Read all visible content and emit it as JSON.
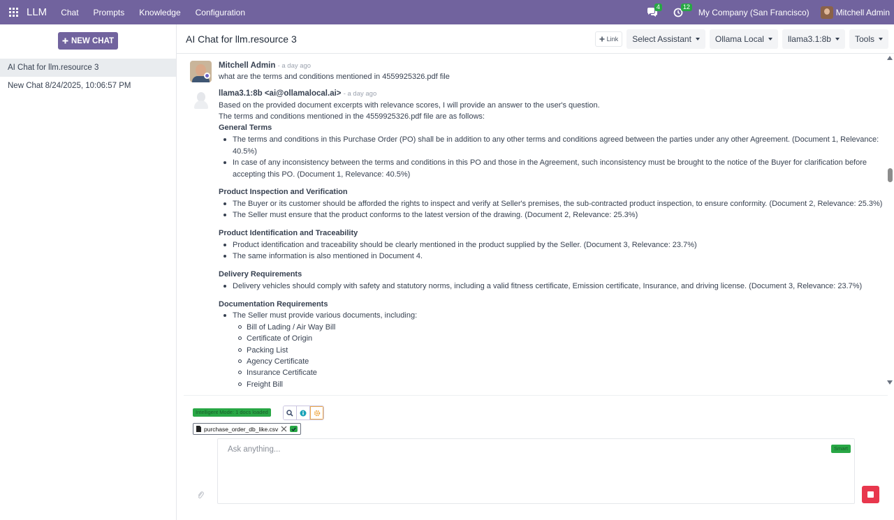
{
  "topbar": {
    "brand": "LLM",
    "menu": [
      "Chat",
      "Prompts",
      "Knowledge",
      "Configuration"
    ],
    "messages_count": "4",
    "activities_count": "12",
    "company": "My Company (San Francisco)",
    "user": "Mitchell Admin"
  },
  "sidebar": {
    "new_chat_label": "NEW CHAT",
    "items": [
      {
        "label": "AI Chat for llm.resource 3",
        "active": true
      },
      {
        "label": "New Chat 8/24/2025, 10:06:57 PM",
        "active": false
      }
    ]
  },
  "header": {
    "title": "AI Chat for llm.resource 3",
    "link_label": "Link",
    "assistant": "Select Assistant",
    "provider": "Ollama Local",
    "model": "llama3.1:8b",
    "tools": "Tools"
  },
  "messages": {
    "user": {
      "author": "Mitchell Admin",
      "time": "- a day ago",
      "text": "what are the terms and conditions mentioned in 4559925326.pdf file"
    },
    "bot": {
      "author": "llama3.1:8b <ai@ollamalocal.ai>",
      "time": "- a day ago",
      "intro1": "Based on the provided document excerpts with relevance scores, I will provide an answer to the user's question.",
      "intro2": "The terms and conditions mentioned in the 4559925326.pdf file are as follows:",
      "sections": [
        {
          "title": "General Terms",
          "bullets": [
            "The terms and conditions in this Purchase Order (PO) shall be in addition to any other terms and conditions agreed between the parties under any other Agreement. (Document 1, Relevance: 40.5%)",
            "In case of any inconsistency between the terms and conditions in this PO and those in the Agreement, such inconsistency must be brought to the notice of the Buyer for clarification before accepting this PO. (Document 1, Relevance: 40.5%)"
          ]
        },
        {
          "title": "Product Inspection and Verification",
          "bullets": [
            "The Buyer or its customer should be afforded the rights to inspect and verify at Seller's premises, the sub-contracted product inspection, to ensure conformity. (Document 2, Relevance: 25.3%)",
            "The Seller must ensure that the product conforms to the latest version of the drawing. (Document 2, Relevance: 25.3%)"
          ]
        },
        {
          "title": "Product Identification and Traceability",
          "bullets": [
            "Product identification and traceability should be clearly mentioned in the product supplied by the Seller. (Document 3, Relevance: 23.7%)",
            "The same information is also mentioned in Document 4."
          ]
        },
        {
          "title": "Delivery Requirements",
          "bullets": [
            "Delivery vehicles should comply with safety and statutory norms, including a valid fitness certificate, Emission certificate, Insurance, and driving license. (Document 3, Relevance: 23.7%)"
          ]
        },
        {
          "title": "Documentation Requirements",
          "bullets": [
            "The Seller must provide various documents, including:"
          ],
          "sub_bullets": [
            "Bill of Lading / Air Way Bill",
            "Certificate of Origin",
            "Packing List",
            "Agency Certificate",
            "Insurance Certificate",
            "Freight Bill"
          ]
        }
      ]
    }
  },
  "composer": {
    "mode_badge": "Intelligent Mode: 1 docs loaded",
    "file_name": "purchase_order_db_like.csv",
    "placeholder": "Ask anything...",
    "smart_badge": "Smart"
  },
  "colors": {
    "brand": "#71639e",
    "success": "#28a745",
    "stop": "#e8374d"
  }
}
